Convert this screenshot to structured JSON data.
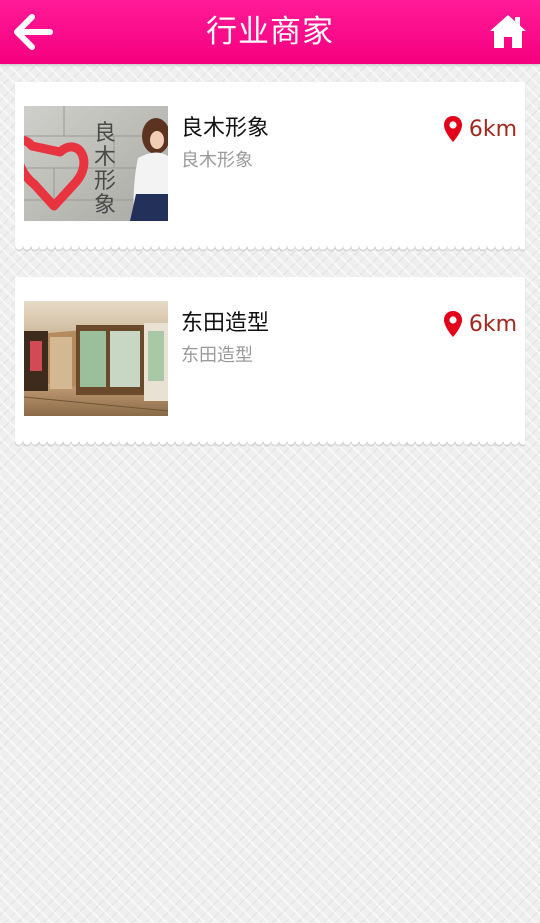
{
  "header": {
    "title": "行业商家",
    "back_icon": "arrow-left-icon",
    "home_icon": "home-icon",
    "bar_color": "#f5007f"
  },
  "merchants": [
    {
      "name": "良木形象",
      "subtitle": "良木形象",
      "distance": "6km",
      "thumb_text": "良木形象"
    },
    {
      "name": "东田造型",
      "subtitle": "东田造型",
      "distance": "6km"
    }
  ],
  "colors": {
    "accent": "#f5007f",
    "distance": "#a0281e",
    "pin": "#e3001b"
  }
}
